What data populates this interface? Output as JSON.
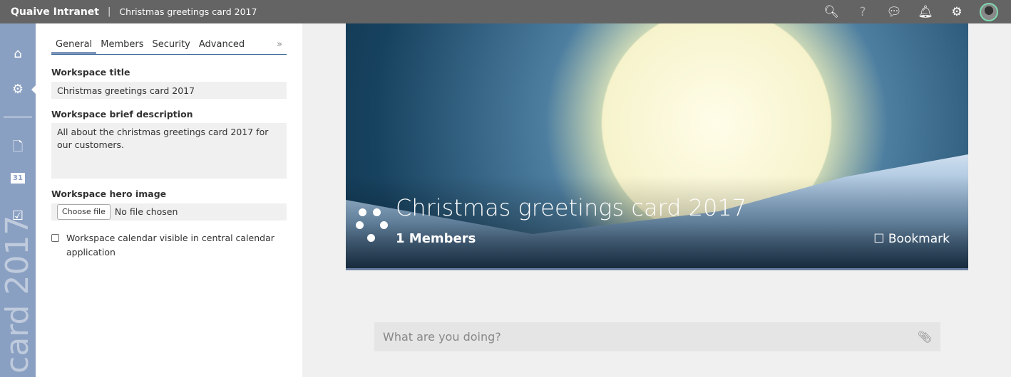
{
  "topbar": {
    "brand": "Quaive Intranet",
    "separator": "|",
    "breadcrumb": "Christmas greetings card 2017"
  },
  "sidebar": {
    "vertical_text": "card 2017",
    "calendar_day": "31"
  },
  "tabs": [
    {
      "label": "General"
    },
    {
      "label": "Members"
    },
    {
      "label": "Security"
    },
    {
      "label": "Advanced"
    }
  ],
  "more": "»",
  "form": {
    "title_label": "Workspace title",
    "title_value": "Christmas greetings card 2017",
    "desc_label": "Workspace brief description",
    "desc_value": "All about the christmas greetings card 2017 for our customers.",
    "hero_label": "Workspace hero image",
    "choose_file": "Choose file",
    "no_file": "No file chosen",
    "calendar_label": "Workspace calendar visible in central calendar application"
  },
  "hero": {
    "title": "Christmas greetings card 2017",
    "members": "1 Members",
    "bookmark": "Bookmark"
  },
  "post": {
    "placeholder": "What are you doing?"
  }
}
